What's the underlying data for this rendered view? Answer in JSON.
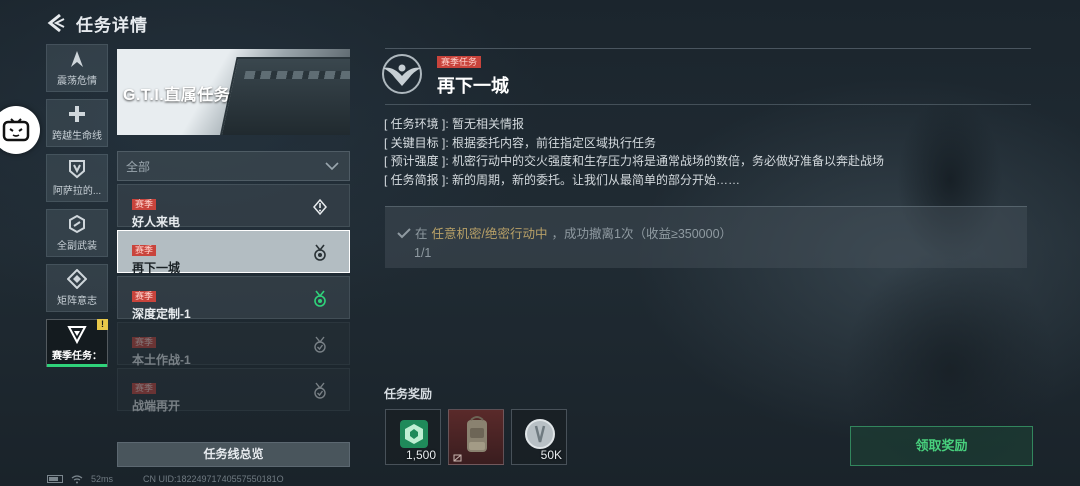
{
  "header": {
    "title": "任务详情"
  },
  "sidenav": [
    {
      "label": "震荡危情",
      "icon": "shard-icon"
    },
    {
      "label": "跨越生命线",
      "icon": "cross-icon"
    },
    {
      "label": "阿萨拉的...",
      "icon": "shield-v-icon"
    },
    {
      "label": "全副武装",
      "icon": "hexagon-icon"
    },
    {
      "label": "矩阵意志",
      "icon": "diamond-icon"
    },
    {
      "label": "赛季任务：",
      "icon": "triangle-icon",
      "active": true,
      "badge": "!"
    }
  ],
  "banner": {
    "title": "G.T.I.直属任务"
  },
  "filter": {
    "value": "全部"
  },
  "tasks": [
    {
      "tag": "赛季",
      "name": "好人来电",
      "state": "available"
    },
    {
      "tag": "赛季",
      "name": "再下一城",
      "state": "selected"
    },
    {
      "tag": "赛季",
      "name": "深度定制-1",
      "state": "claimable"
    },
    {
      "tag": "赛季",
      "name": "本土作战-1",
      "state": "locked"
    },
    {
      "tag": "赛季",
      "name": "战端再开",
      "state": "locked"
    }
  ],
  "overview_button": "任务线总览",
  "detail": {
    "tag": "赛季任务",
    "title": "再下一城",
    "info": [
      {
        "key": "[ 任务环境 ]:",
        "value": "暂无相关情报"
      },
      {
        "key": "[ 关键目标 ]:",
        "value": "根据委托内容，前往指定区域执行任务"
      },
      {
        "key": "[ 预计强度 ]:",
        "value": "机密行动中的交火强度和生存压力将是通常战场的数倍，务必做好准备以奔赴战场"
      },
      {
        "key": "[ 任务简报 ]:",
        "value": "新的周期，新的委托。让我们从最简单的部分开始……"
      }
    ],
    "objective": {
      "prefix": "在",
      "highlight": "任意机密/绝密行动中",
      "suffix": "，成功撤离1次（收益≥350000）",
      "progress": "1/1"
    }
  },
  "rewards": {
    "label": "任务奖励",
    "items": [
      {
        "icon": "green-badge-icon",
        "count": "1,500"
      },
      {
        "icon": "backpack-icon",
        "count": ""
      },
      {
        "icon": "silver-coin-icon",
        "count": "50K"
      }
    ]
  },
  "claim_button": "领取奖励",
  "status": {
    "ping": "52ms",
    "uid": "CN UID:18224971740557550181O"
  },
  "colors": {
    "accent_green": "#48d07d",
    "season_red": "#c9443c",
    "highlight_gold": "#b8a067"
  }
}
